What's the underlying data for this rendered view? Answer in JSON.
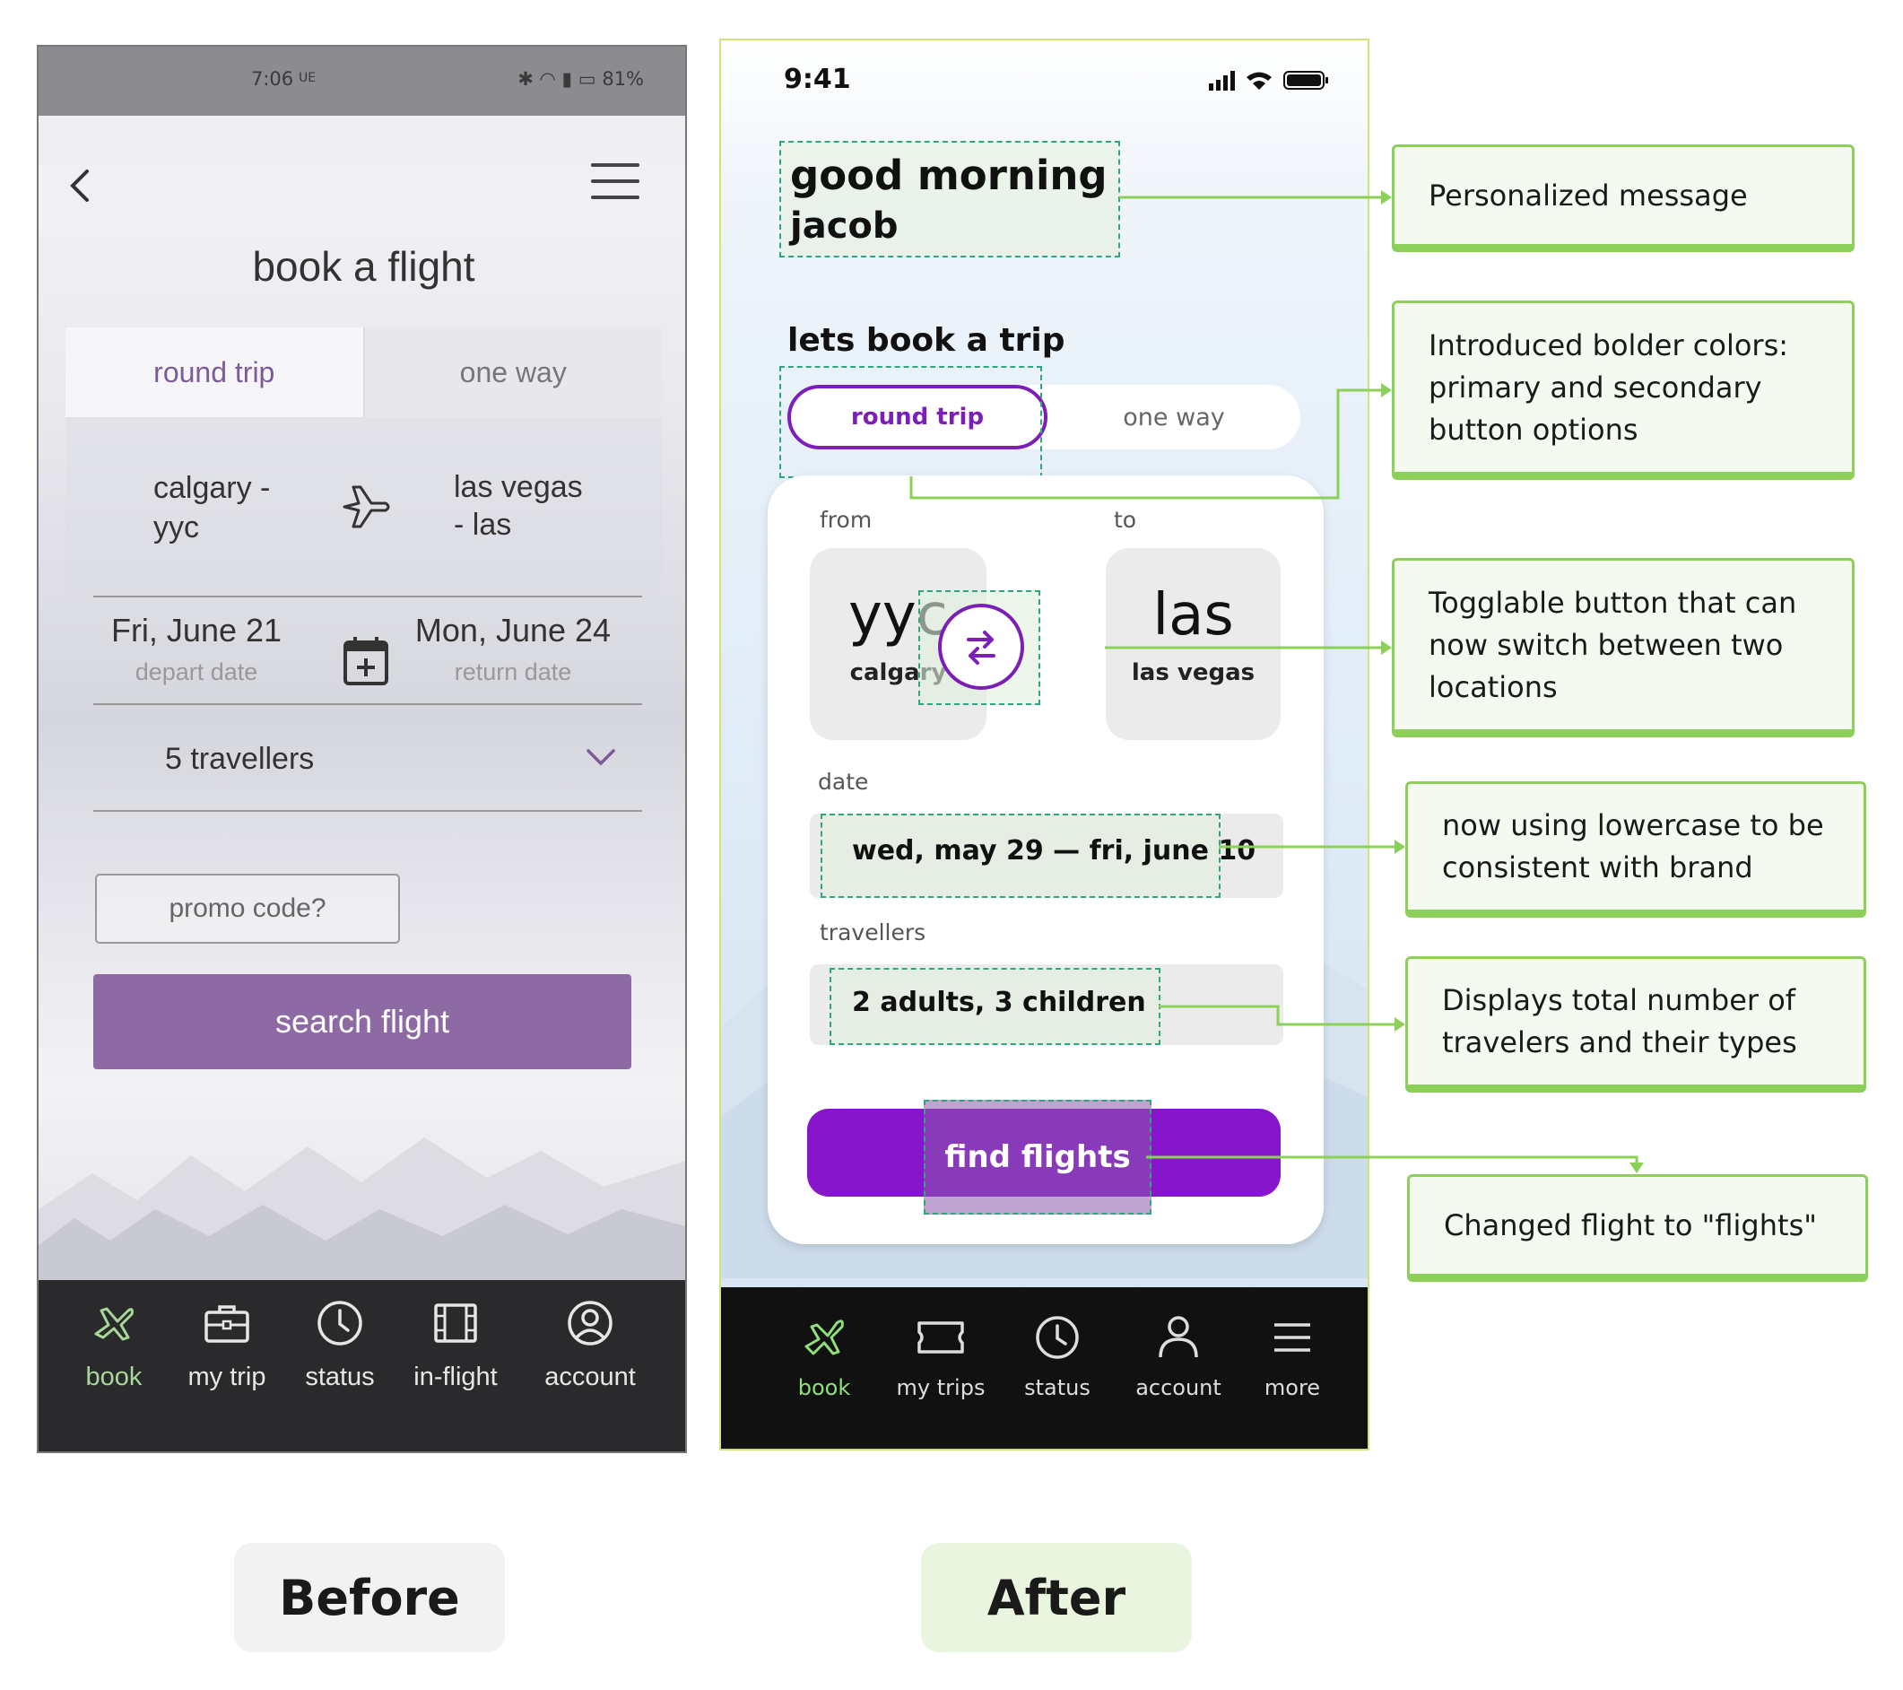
{
  "before": {
    "status_bar": {
      "time": "7:06",
      "carrier": "UE",
      "battery": "81%"
    },
    "title": "book a flight",
    "tabs": [
      {
        "label": "round trip"
      },
      {
        "label": "one way"
      }
    ],
    "route": {
      "from_line1": "calgary -",
      "from_line2": "yyc",
      "to_line1": "las vegas",
      "to_line2": "- las"
    },
    "dates": {
      "depart_value": "Fri, June 21",
      "depart_label": "depart date",
      "return_value": "Mon, June 24",
      "return_label": "return date"
    },
    "travellers": "5 travellers",
    "promo_placeholder": "promo code?",
    "search_button": "search flight",
    "nav": [
      {
        "label": "book",
        "icon": "plane-icon"
      },
      {
        "label": "my trip",
        "icon": "briefcase-icon"
      },
      {
        "label": "status",
        "icon": "clock-icon"
      },
      {
        "label": "in-flight",
        "icon": "film-icon"
      },
      {
        "label": "account",
        "icon": "user-circle-icon"
      }
    ],
    "caption": "Before"
  },
  "after": {
    "status_bar": {
      "time": "9:41"
    },
    "greeting_line1": "good morning",
    "greeting_line2": "jacob",
    "heading": "lets book a trip",
    "tabs": [
      {
        "label": "round trip"
      },
      {
        "label": "one way"
      }
    ],
    "from_label": "from",
    "to_label": "to",
    "from_code": "yyc",
    "from_city": "calgary",
    "to_code": "las",
    "to_city": "las vegas",
    "date_label": "date",
    "date_start": "wed, may 29",
    "date_sep": "—",
    "date_end": "fri, june 10",
    "travellers_label": "travellers",
    "travellers_value": "2 adults, 3 children",
    "find_button": "find flights",
    "nav": [
      {
        "label": "book",
        "icon": "plane-icon"
      },
      {
        "label": "my trips",
        "icon": "ticket-icon"
      },
      {
        "label": "status",
        "icon": "clock-icon"
      },
      {
        "label": "account",
        "icon": "user-icon"
      },
      {
        "label": "more",
        "icon": "menu-icon"
      }
    ],
    "caption": "After"
  },
  "notes": [
    "Personalized message",
    "Introduced bolder colors: primary and secondary button options",
    "Togglable button  that can now switch between two locations",
    "now using lowercase to be consistent with brand",
    "Displays total number of travelers and their types",
    "Changed flight to \"flights\""
  ],
  "colors": {
    "before_primary": "#8e6aa5",
    "after_primary": "#8615cc",
    "annotation_green": "#8cd05a",
    "highlight_dash": "#2ea87a"
  }
}
